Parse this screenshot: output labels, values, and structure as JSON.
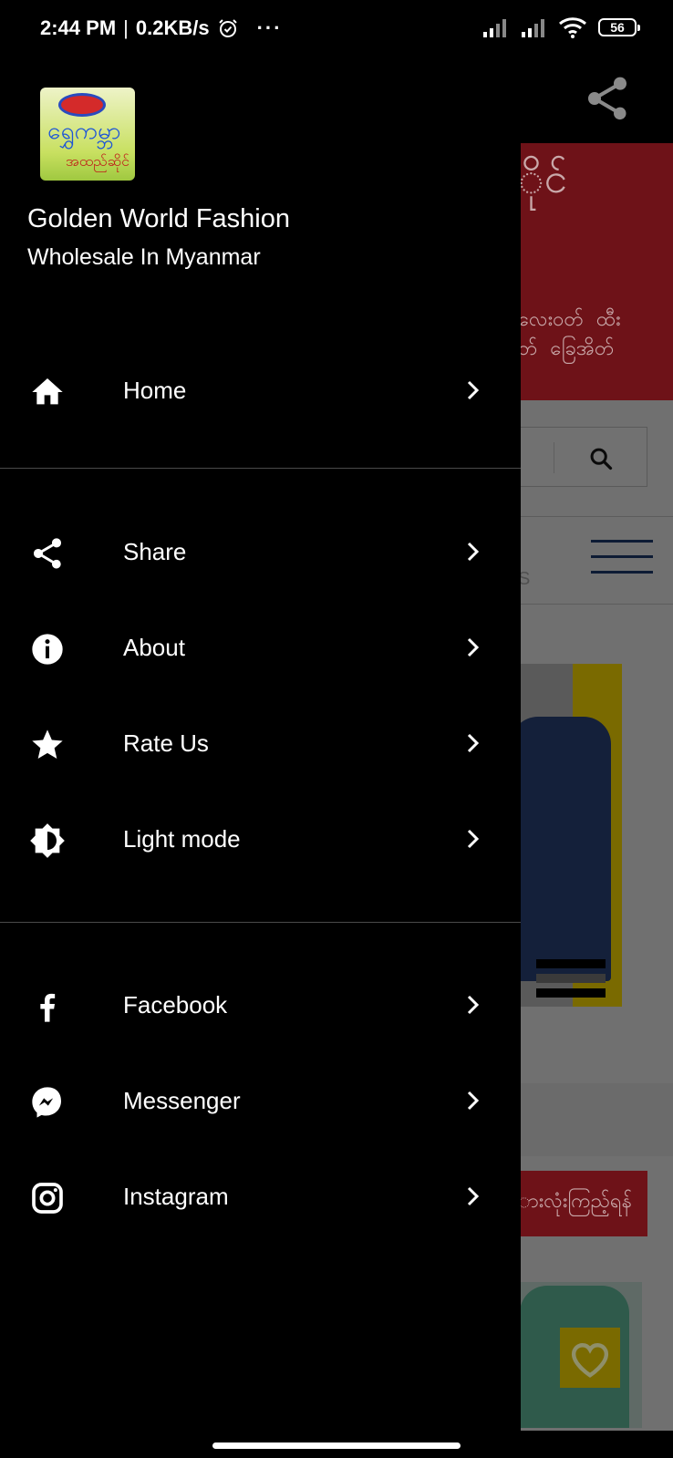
{
  "status_bar": {
    "time": "2:44 PM",
    "separator": "|",
    "speed": "0.2KB/s",
    "more": "···",
    "battery": "56"
  },
  "drawer": {
    "logo_text_top": "ရွှေကမ္ဘာ",
    "logo_text_bottom": "အထည်ဆိုင်",
    "title": "Golden World Fashion",
    "subtitle": "Wholesale In Myanmar",
    "items": [
      {
        "label": "Home",
        "icon": "home-icon"
      },
      {
        "label": "Share",
        "icon": "share-icon"
      },
      {
        "label": "About",
        "icon": "info-icon"
      },
      {
        "label": "Rate Us",
        "icon": "star-icon"
      },
      {
        "label": "Light mode",
        "icon": "brightness-icon"
      },
      {
        "label": "Facebook",
        "icon": "facebook-icon"
      },
      {
        "label": "Messenger",
        "icon": "messenger-icon"
      },
      {
        "label": "Instagram",
        "icon": "instagram-icon"
      }
    ]
  },
  "background": {
    "banner_title": "ိုင်",
    "banner_text": "လေးဝတ်  ထီး\nတ်  ခြေအိတ်",
    "category_partial": "S",
    "view_all_button": "ားလုံးကြည့်ရန်"
  },
  "colors": {
    "drawer_bg": "#000000",
    "banner_red": "#6e1218",
    "accent_yellow": "#7a6a00"
  }
}
